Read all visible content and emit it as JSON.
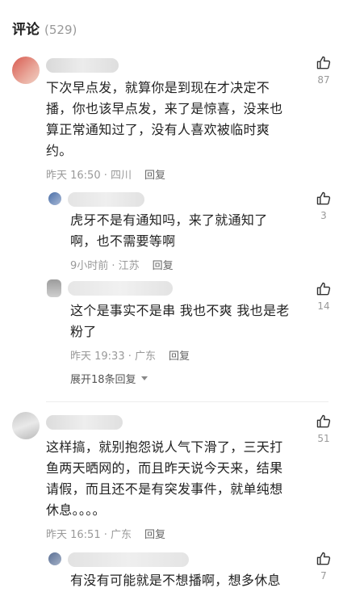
{
  "header": {
    "title": "评论",
    "count": "(529)"
  },
  "comments": [
    {
      "text": "下次早点发，就算你是到现在才决定不播，你也该早点发，来了是惊喜，没来也算正常通知过了，没有人喜欢被临时爽约。",
      "time_location": "昨天 16:50 · 四川",
      "reply_label": "回复",
      "likes": "87",
      "replies": [
        {
          "text": "虎牙不是有通知吗，来了就通知了啊，也不需要等啊",
          "time_location": "9小时前 · 江苏",
          "reply_label": "回复",
          "likes": "3"
        },
        {
          "text": "这个是事实不是串 我也不爽 我也是老粉了",
          "time_location": "昨天 19:33 · 广东",
          "reply_label": "回复",
          "likes": "14"
        }
      ],
      "expand_label": "展开18条回复"
    },
    {
      "text": "这样搞，就别抱怨说人气下滑了，三天打鱼两天晒网的，而且昨天说今天来，结果请假，而且还不是有突发事件，就单纯想休息。。。。",
      "time_location": "昨天 16:51 · 广东",
      "reply_label": "回复",
      "likes": "51",
      "replies": [
        {
          "text": "有没有可能就是不想播啊，想多休息",
          "likes": "7"
        }
      ]
    }
  ],
  "icons": {
    "like": "thumbs-up-icon",
    "expand": "caret-down-icon"
  },
  "colors": {
    "meta": "#999999",
    "text": "#222222",
    "divider": "#ececec"
  }
}
